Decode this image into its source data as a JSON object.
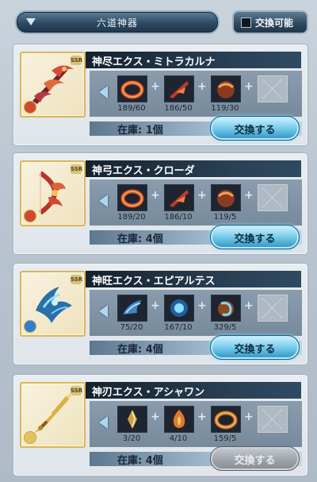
{
  "header": {
    "dropdown_label": "六道神器",
    "toggle_label": "交換可能"
  },
  "colors": {
    "exchange_button": "#7fd0ee",
    "exchange_disabled": "#9aa1a7",
    "title_bar": "#14212e"
  },
  "cards": [
    {
      "title": "神尽エクス・ミトラカルナ",
      "element": "fire",
      "weapon_icon": "red-scythe-weapon-icon",
      "materials": [
        {
          "icon": "red-ring-material-icon",
          "count": "189/60"
        },
        {
          "icon": "red-blade-material-icon",
          "count": "186/50"
        },
        {
          "icon": "red-orb-material-icon",
          "count": "119/30"
        },
        {
          "icon": "empty-slot-icon",
          "count": ""
        }
      ],
      "stock": "在庫: 1個",
      "button": "交換する",
      "enabled": true
    },
    {
      "title": "神弓エクス・クローダ",
      "element": "fire",
      "weapon_icon": "red-bow-weapon-icon",
      "materials": [
        {
          "icon": "red-ring-material-icon",
          "count": "189/20"
        },
        {
          "icon": "red-blade-material-icon",
          "count": "186/10"
        },
        {
          "icon": "red-orb-material-icon",
          "count": "119/5"
        },
        {
          "icon": "empty-slot-icon",
          "count": ""
        }
      ],
      "stock": "在庫: 4個",
      "button": "交換する",
      "enabled": true
    },
    {
      "title": "神旺エクス・エピアルテス",
      "element": "water",
      "weapon_icon": "blue-claw-weapon-icon",
      "materials": [
        {
          "icon": "blue-claw-material-icon",
          "count": "75/20"
        },
        {
          "icon": "blue-orb-material-icon",
          "count": "167/10"
        },
        {
          "icon": "blue-hook-material-icon",
          "count": "329/5"
        },
        {
          "icon": "empty-slot-icon",
          "count": ""
        }
      ],
      "stock": "在庫: 4個",
      "button": "交換する",
      "enabled": true
    },
    {
      "title": "神刃エクス・アシャワン",
      "element": "light",
      "weapon_icon": "gold-sword-weapon-icon",
      "materials": [
        {
          "icon": "gold-shard-material-icon",
          "count": "3/20"
        },
        {
          "icon": "gold-flame-material-icon",
          "count": "4/10"
        },
        {
          "icon": "gold-ring-material-icon",
          "count": "159/5"
        },
        {
          "icon": "empty-slot-icon",
          "count": ""
        }
      ],
      "stock": "在庫: 4個",
      "button": "交換する",
      "enabled": false
    }
  ]
}
